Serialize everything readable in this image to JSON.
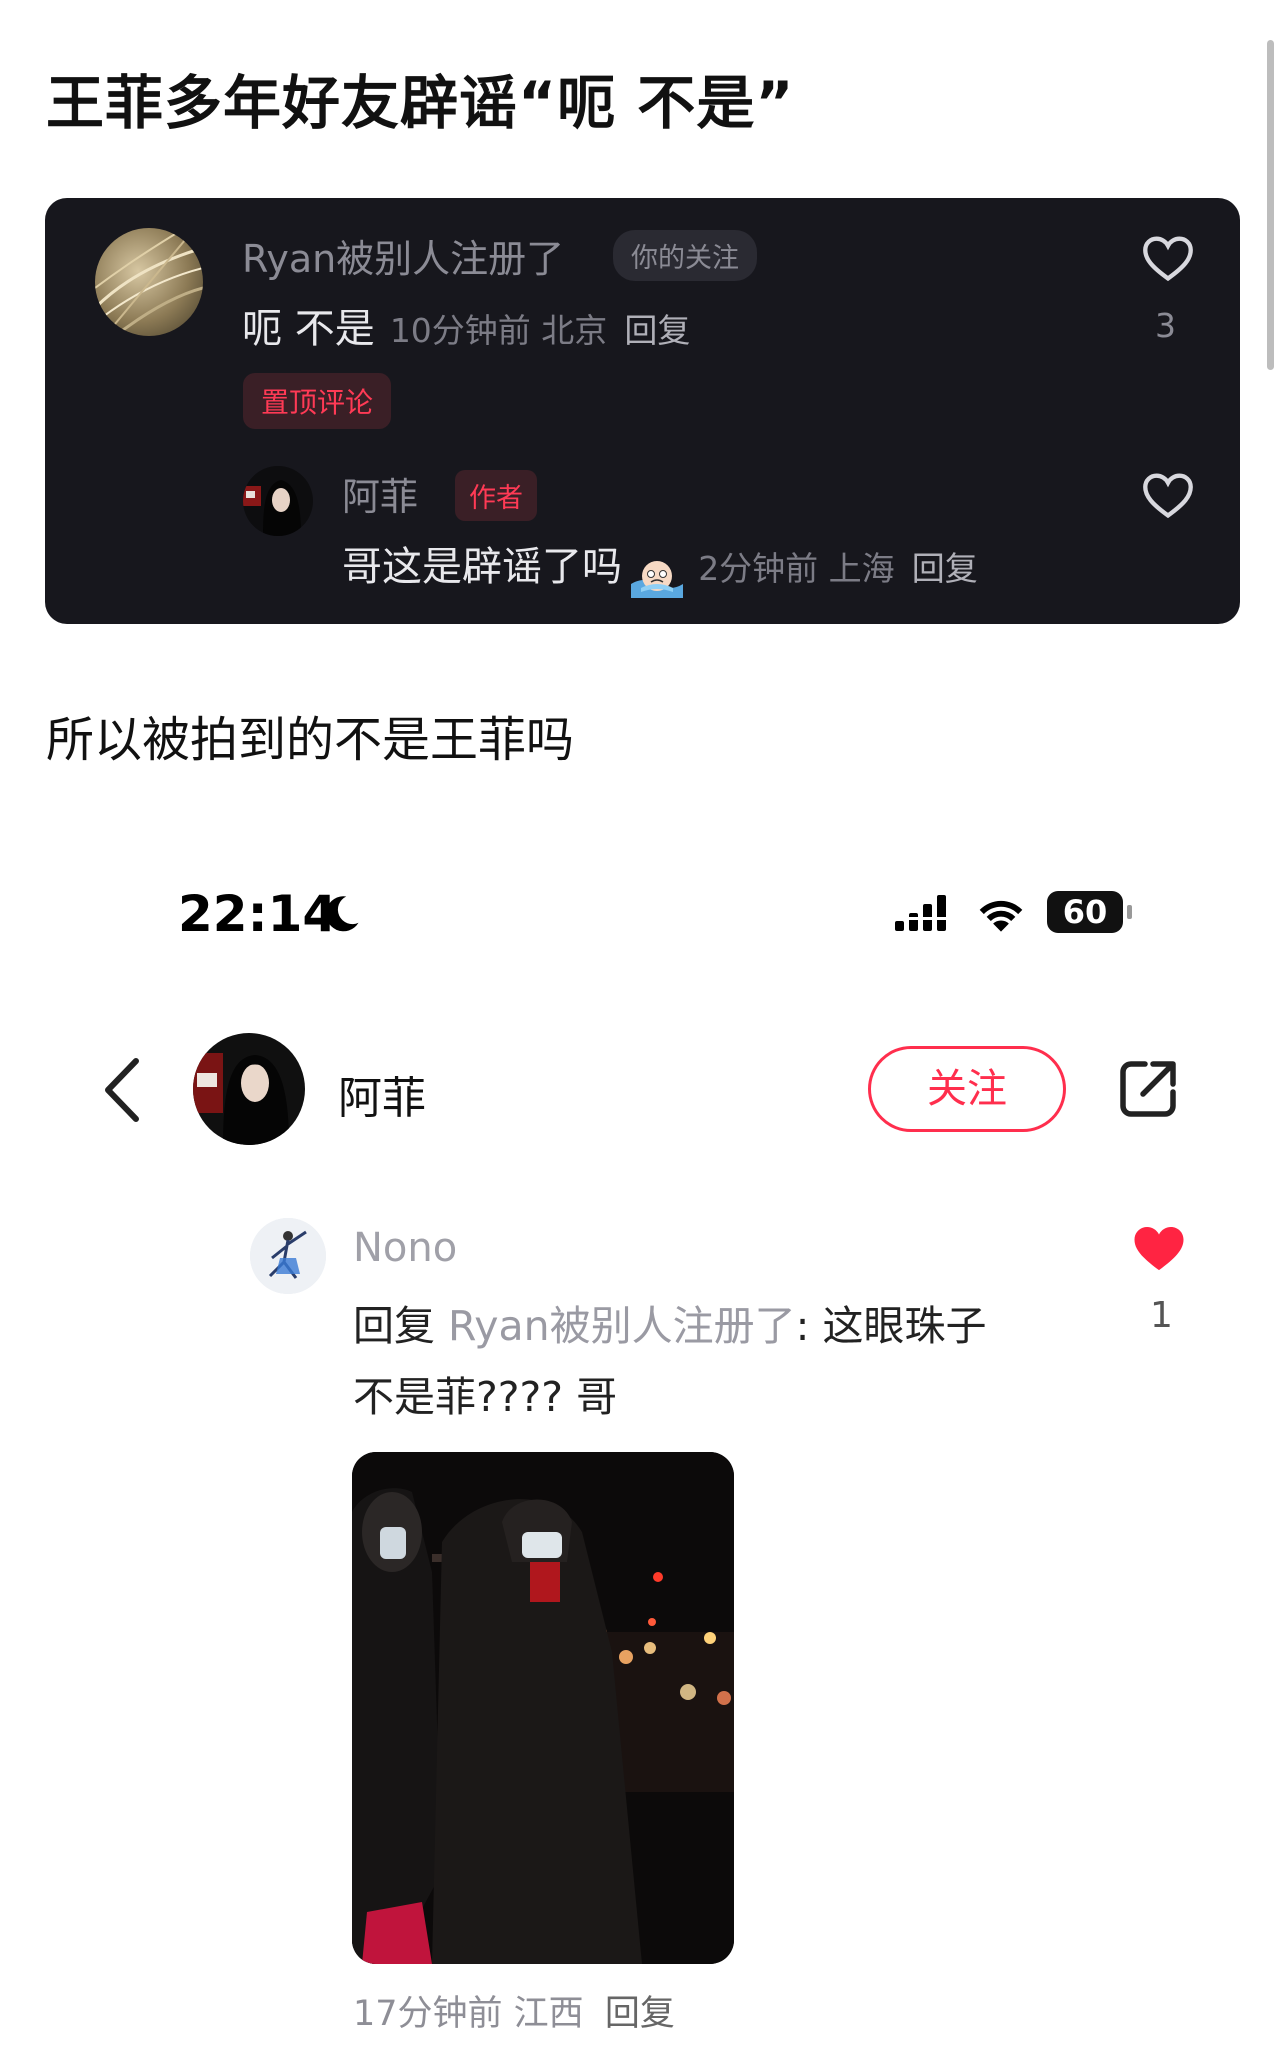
{
  "post": {
    "title": "王菲多年好友辟谣“呃 不是”",
    "body": "所以被拍到的不是王菲吗"
  },
  "comment_card": {
    "comment": {
      "user": "Ryan被别人注册了",
      "badge": "你的关注",
      "text": "呃 不是",
      "meta": "10分钟前 北京",
      "reply_label": "回复",
      "likes": "3",
      "pinned_label": "置顶评论"
    },
    "reply": {
      "user": "阿菲",
      "badge": "作者",
      "text": "哥这是辟谣了吗",
      "meta": "2分钟前 上海",
      "reply_label": "回复"
    }
  },
  "status_bar": {
    "time": "22:14",
    "battery": "60"
  },
  "nav": {
    "user": "阿菲",
    "follow_label": "关注"
  },
  "thread_reply": {
    "user": "Nono",
    "prefix": "回复",
    "reply_to": "Ryan被别人注册了",
    "text_line1": ": 这眼珠子",
    "text_line2": "不是菲???? 哥",
    "likes": "1",
    "like_color": "#ff2442",
    "meta": "17分钟前 江西",
    "reply_label": "回复"
  }
}
